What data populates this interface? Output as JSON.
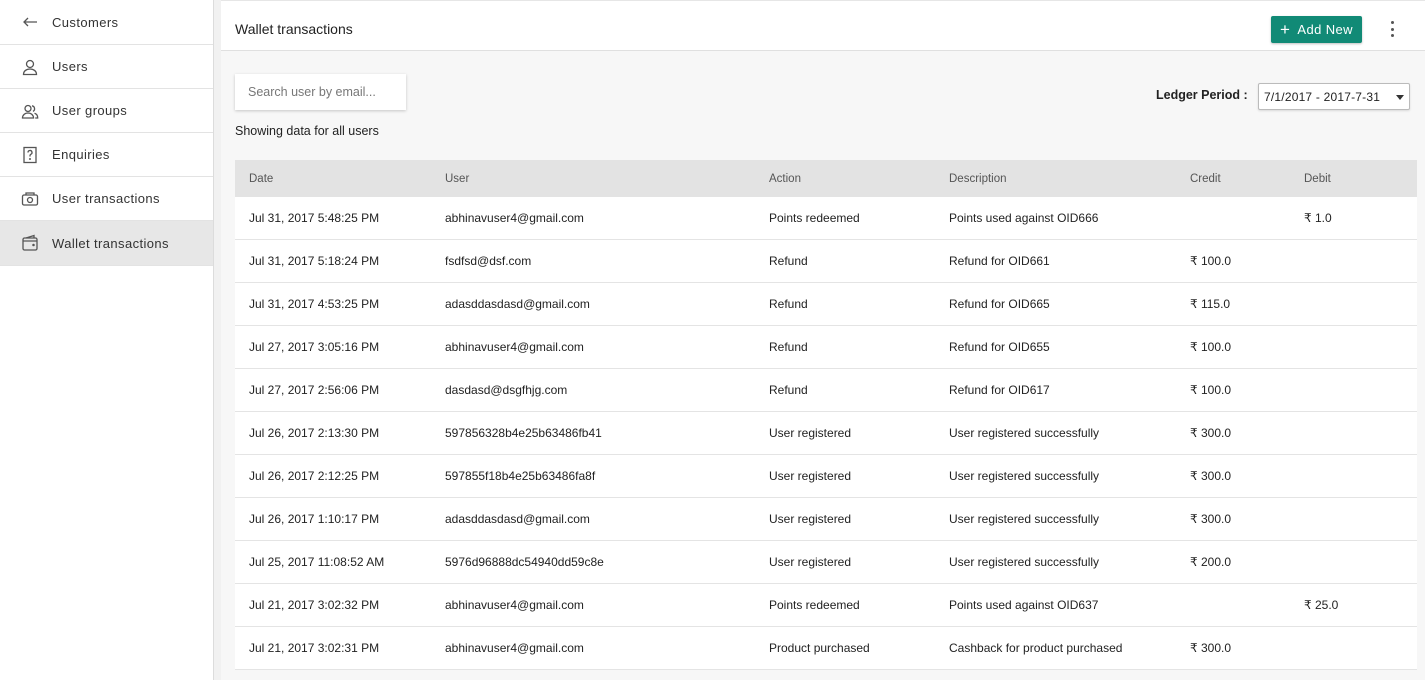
{
  "sidebar": {
    "back_label": "Customers",
    "items": [
      {
        "label": "Users",
        "icon": "user-icon"
      },
      {
        "label": "User groups",
        "icon": "user-group-icon"
      },
      {
        "label": "Enquiries",
        "icon": "question-icon"
      },
      {
        "label": "User transactions",
        "icon": "transactions-icon"
      },
      {
        "label": "Wallet transactions",
        "icon": "wallet-icon",
        "active": true
      }
    ]
  },
  "header": {
    "title": "Wallet transactions",
    "add_label": "Add New"
  },
  "filters": {
    "search_placeholder": "Search user by email...",
    "showing_text": "Showing data for all users",
    "ledger_label": "Ledger Period :",
    "ledger_value": "7/1/2017 - 2017-7-31"
  },
  "table": {
    "columns": [
      "Date",
      "User",
      "Action",
      "Description",
      "Credit",
      "Debit"
    ],
    "rows": [
      [
        "Jul 31, 2017 5:48:25 PM",
        "abhinavuser4@gmail.com",
        "Points redeemed",
        "Points used against OID666",
        "",
        "₹ 1.0"
      ],
      [
        "Jul 31, 2017 5:18:24 PM",
        "fsdfsd@dsf.com",
        "Refund",
        "Refund for OID661",
        "₹ 100.0",
        ""
      ],
      [
        "Jul 31, 2017 4:53:25 PM",
        "adasddasdasd@gmail.com",
        "Refund",
        "Refund for OID665",
        "₹ 115.0",
        ""
      ],
      [
        "Jul 27, 2017 3:05:16 PM",
        "abhinavuser4@gmail.com",
        "Refund",
        "Refund for OID655",
        "₹ 100.0",
        ""
      ],
      [
        "Jul 27, 2017 2:56:06 PM",
        "dasdasd@dsgfhjg.com",
        "Refund",
        "Refund for OID617",
        "₹ 100.0",
        ""
      ],
      [
        "Jul 26, 2017 2:13:30 PM",
        "597856328b4e25b63486fb41",
        "User registered",
        "User registered successfully",
        "₹ 300.0",
        ""
      ],
      [
        "Jul 26, 2017 2:12:25 PM",
        "597855f18b4e25b63486fa8f",
        "User registered",
        "User registered successfully",
        "₹ 300.0",
        ""
      ],
      [
        "Jul 26, 2017 1:10:17 PM",
        "adasddasdasd@gmail.com",
        "User registered",
        "User registered successfully",
        "₹ 300.0",
        ""
      ],
      [
        "Jul 25, 2017 11:08:52 AM",
        "5976d96888dc54940dd59c8e",
        "User registered",
        "User registered successfully",
        "₹ 200.0",
        ""
      ],
      [
        "Jul 21, 2017 3:02:32 PM",
        "abhinavuser4@gmail.com",
        "Points redeemed",
        "Points used against OID637",
        "",
        "₹ 25.0"
      ],
      [
        "Jul 21, 2017 3:02:31 PM",
        "abhinavuser4@gmail.com",
        "Product purchased",
        "Cashback for product purchased",
        "₹ 300.0",
        ""
      ]
    ]
  },
  "colors": {
    "accent": "#118a76",
    "active_bg": "#e7e7e7"
  }
}
